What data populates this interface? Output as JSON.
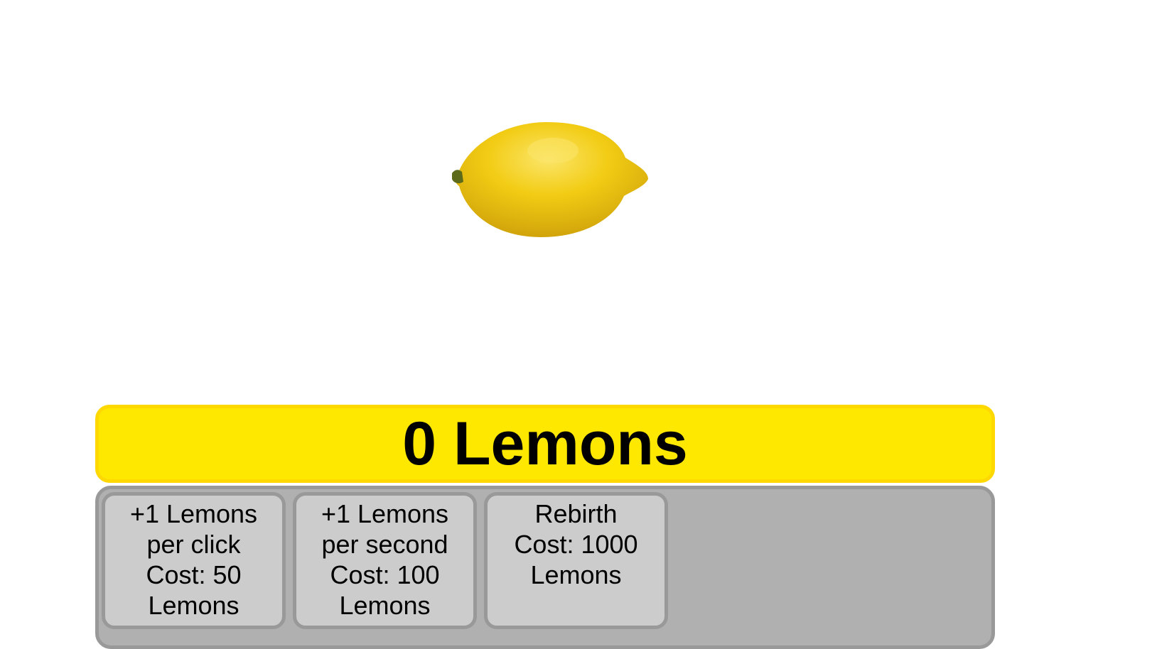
{
  "lemon": {
    "icon": "lemon-icon",
    "colors": {
      "fill": "#f2cc14",
      "shade": "#d9ad0c",
      "highlight": "#fbe56a",
      "stem": "#5c6a1a"
    }
  },
  "counter": {
    "text": "0 Lemons",
    "background": "#ffe800"
  },
  "shop": {
    "items": [
      {
        "lines": [
          "+1 Lemons",
          "per click",
          "Cost: 50",
          "Lemons"
        ]
      },
      {
        "lines": [
          "+1 Lemons",
          "per second",
          "Cost: 100",
          "Lemons"
        ]
      },
      {
        "lines": [
          "Rebirth",
          "Cost: 1000",
          "Lemons"
        ]
      }
    ]
  }
}
